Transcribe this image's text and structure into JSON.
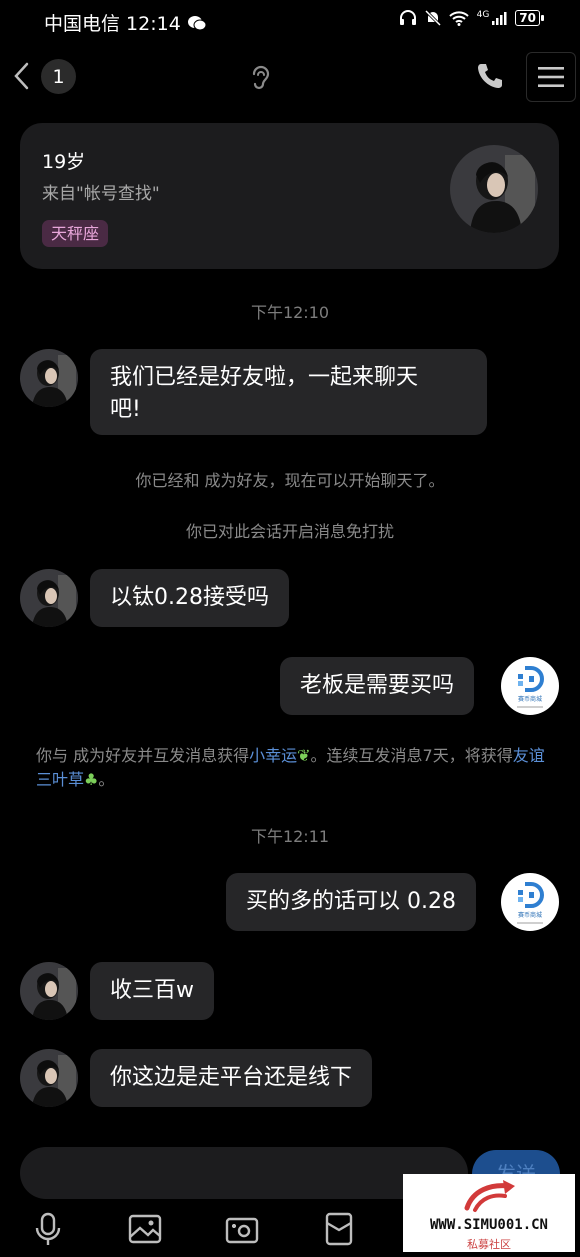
{
  "status_bar": {
    "carrier_time": "中国电信 12:14",
    "network": "4G",
    "battery": "70"
  },
  "header": {
    "unread_count": "1"
  },
  "profile": {
    "age": "19岁",
    "source": "来自\"帐号查找\"",
    "zodiac_tag": "天秤座"
  },
  "messages": {
    "time_1": "下午12:10",
    "msg_1": "我们已经是好友啦，一起来聊天",
    "msg_1b": "吧!",
    "sys_1": "你已经和   成为好友，现在可以开始聊天了。",
    "sys_2": "你已对此会话开启消息免打扰",
    "msg_2": "以钛0.28接受吗",
    "msg_3": "老板是需要买吗",
    "sys_3_a": "你与   成为好友并互发消息获得",
    "sys_3_hl1": "小幸运",
    "sys_3_b": "。连续互发消息7天，将获得",
    "sys_3_hl2": "友谊三叶草",
    "sys_3_c": "。",
    "time_2": "下午12:11",
    "msg_4": "买的多的话可以 0.28",
    "msg_5": "收三百w",
    "msg_6": "你这边是走平台还是线下"
  },
  "bot_avatar_label": "赛币商城",
  "input": {
    "send_label": "发送"
  },
  "watermark": {
    "url": "WWW.SIMU001.CN",
    "subtitle": "私募社区"
  },
  "colors": {
    "background": "#000000",
    "bubble": "#262628",
    "card": "#1c1c1e",
    "tag_text": "#e8a6da",
    "link": "#5b8fd6",
    "send_button": "#1d4e8e"
  }
}
